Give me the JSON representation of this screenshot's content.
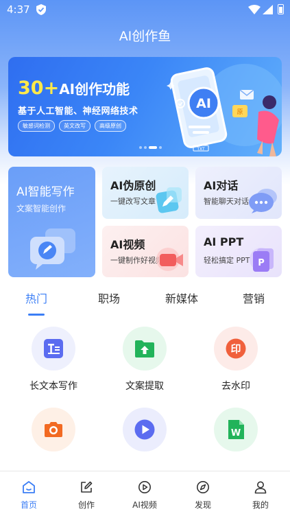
{
  "status_bar": {
    "time": "4:37"
  },
  "app": {
    "title": "AI创作鱼"
  },
  "banner": {
    "headline_number": "30+",
    "headline_text": "AI创作功能",
    "subtitle": "基于人工智能、神经网络技术",
    "tags": [
      "敏感词检测",
      "英文改写",
      "高级原创"
    ],
    "art_ai_text": "AI",
    "art_tag": "TXT"
  },
  "features": {
    "writing": {
      "title": "AI智能写作",
      "desc": "文案智能创作"
    },
    "rewrite": {
      "title": "AI伪原创",
      "desc": "一键改写文章"
    },
    "chat": {
      "title": "AI对话",
      "desc": "智能聊天对话"
    },
    "video": {
      "title": "AI视频",
      "desc": "一键制作好视频"
    },
    "ppt": {
      "title": "AI PPT",
      "desc": "轻松搞定 PPT"
    }
  },
  "tabs": [
    "热门",
    "职场",
    "新媒体",
    "营销"
  ],
  "active_tab": "热门",
  "tools": [
    {
      "label": "长文本写作",
      "icon": "long-text-icon",
      "color": "#5b6cf0"
    },
    {
      "label": "文案提取",
      "icon": "folder-upload-icon",
      "color": "#22b35a"
    },
    {
      "label": "去水印",
      "icon": "watermark-stamp-icon",
      "color": "#f0603c",
      "glyph": "印"
    },
    {
      "label": "",
      "icon": "camera-icon",
      "color": "#f26a22"
    },
    {
      "label": "",
      "icon": "play-icon",
      "color": "#5b6cf0"
    },
    {
      "label": "",
      "icon": "word-doc-icon",
      "color": "#22b35a",
      "glyph": "W"
    }
  ],
  "bottom_nav": [
    {
      "label": "首页",
      "icon": "home-icon",
      "active": true
    },
    {
      "label": "创作",
      "icon": "edit-icon",
      "active": false
    },
    {
      "label": "AI视频",
      "icon": "video-play-icon",
      "active": false
    },
    {
      "label": "发现",
      "icon": "compass-icon",
      "active": false
    },
    {
      "label": "我的",
      "icon": "user-icon",
      "active": false
    }
  ],
  "colors": {
    "accent": "#3b7ef5",
    "header": "#5c95f6",
    "banner_highlight": "#ffe94a"
  }
}
